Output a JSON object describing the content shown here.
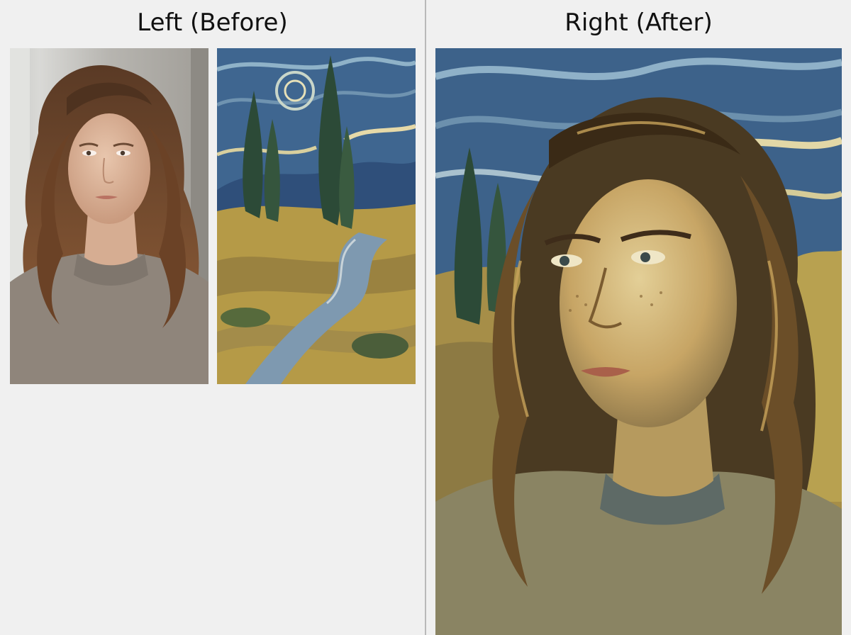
{
  "left_panel": {
    "title": "Left (Before)"
  },
  "right_panel": {
    "title": "Right (After)"
  },
  "images": {
    "photo": {
      "icon": "portrait-photo"
    },
    "painting": {
      "icon": "landscape-painting"
    },
    "result": {
      "icon": "stylized-portrait"
    }
  },
  "colors": {
    "background": "#f0f0f0",
    "divider": "#b9b9b9",
    "sky_blue": "#3f6690",
    "ochre": "#b59a47",
    "cypress": "#2c4a37",
    "hair": "#6b4226",
    "sweater": "#8f857b"
  }
}
